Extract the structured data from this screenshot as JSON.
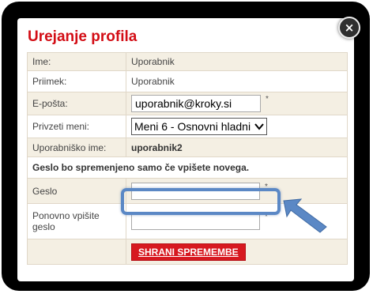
{
  "title": "Urejanje profila",
  "close_symbol": "×",
  "rows": {
    "name": {
      "label": "Ime:",
      "value": "Uporabnik"
    },
    "surname": {
      "label": "Priimek:",
      "value": "Uporabnik"
    },
    "email": {
      "label": "E-pošta:",
      "value": "uporabnik@kroky.si",
      "required_mark": "*"
    },
    "menu": {
      "label": "Privzeti meni:",
      "selected": "Meni 6 - Osnovni hladni"
    },
    "username": {
      "label": "Uporabniško ime:",
      "value": "uporabnik2"
    },
    "notice": "Geslo bo spremenjeno samo če vpišete novega.",
    "password": {
      "label": "Geslo",
      "value": "",
      "required_mark": "*"
    },
    "password_repeat": {
      "label": "Ponovno vpišite geslo",
      "value": "",
      "required_mark": "*"
    }
  },
  "save_button": "SHRANI SPREMEMBE",
  "colors": {
    "title": "#d30d15",
    "button": "#d71920",
    "highlight": "#5b88c5",
    "row_shade": "#f4efe3"
  },
  "icons": {
    "close": "close-icon",
    "select": "chevron-down-icon",
    "pointer": "arrow-pointer-icon"
  }
}
